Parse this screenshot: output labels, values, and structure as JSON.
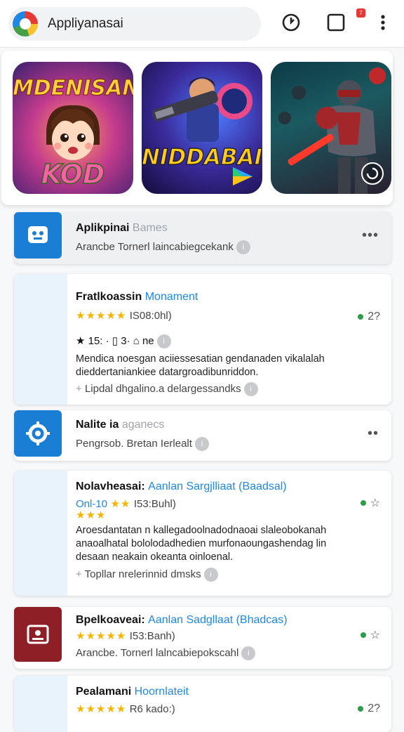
{
  "header": {
    "search_text": "Appliyanasai",
    "badge": "7"
  },
  "hero": {
    "tiles": [
      {
        "title": "MDENISAN",
        "subtitle": "KOD"
      },
      {
        "title": "NIDDABAIN"
      },
      {
        "title": ""
      }
    ]
  },
  "list": [
    {
      "title": "Aplikpinai",
      "title_tag": "Bames",
      "subtitle": "Arancbe Tornerl laincabiegcekank"
    },
    {
      "title": "Fratlkoassin",
      "title_tag": "Monament",
      "stars": "★★★★★",
      "rating": "IS08:0hl)",
      "side": "2?",
      "meta": "★ 15: · ▯ 3· ⌂ ne",
      "desc1": "Mendica noesgan aciiessesatian gendanaden vikalalah",
      "desc2": "dieddertaniankiee datargroadibunriddon.",
      "footer": "Lipdal dhgalino.a delargessandks"
    },
    {
      "title": "Nalite ia",
      "title_tag": "aganecs",
      "subtitle": "Pengrsob. Bretan Ierlealt"
    },
    {
      "title": "Nolavheasai:",
      "title_tag": "Aanlan Sargjlliaat (Baadsal)",
      "rating_prefix": "Onl-10",
      "stars": "★★",
      "stars2": "★★★",
      "rating": "I53:Buhl)",
      "side": "☆",
      "desc1": "Aroesdantatan n kallegadoolnadodnaoai slaleobokanah",
      "desc2": "anaoalhatal bololodadhedien murfonaoungashendag lin",
      "desc3": "desaan neakain okeanta oinloenal.",
      "footer": "Topllar nrelerinnid dmsks"
    },
    {
      "title": "Bpelkoaveai:",
      "title_tag": "Aanlan Sadgllaat (Bhadcas)",
      "stars": "★★★★★",
      "rating": "I53:Banh)",
      "subtitle": "Arancbe. Tornerl lalncabiepokscahl",
      "side": "☆"
    },
    {
      "title": "Pealamani",
      "title_tag": "Hoornlateit",
      "stars": "★★★★★",
      "rating": "R6 kado:)",
      "side": "2?"
    }
  ]
}
